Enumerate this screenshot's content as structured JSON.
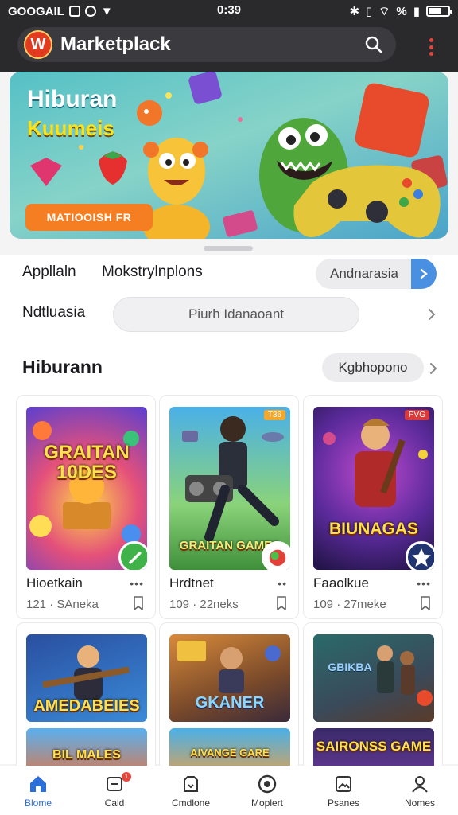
{
  "status_bar": {
    "carrier": "GOOGAIL",
    "time": "0:39",
    "battery": "%"
  },
  "app_bar": {
    "title": "Marketplack"
  },
  "hero": {
    "title": "Hiburan",
    "subtitle": "Kuumeis",
    "cta": "MATIOOISH FR"
  },
  "filters": {
    "label_apps": "Appllaln",
    "label_marketplace": "Mokstrylnplons",
    "language": "Andnarasia",
    "label_national": "Ndtluasia",
    "search_placeholder": "Piurh Idanaoant"
  },
  "section": {
    "title": "Hiburann",
    "category": "Kgbhopono"
  },
  "cards": [
    {
      "art": "GRAITAN 10DES",
      "title": "Hioetkain",
      "meta": "121 · SAneka"
    },
    {
      "art": "GRAITAN GAMES",
      "title": "Hrdtnet",
      "meta": "109 · 22neks",
      "badge": "T36"
    },
    {
      "art": "BIUNAGAS",
      "title": "Faaolkue",
      "meta": "109 · 27meke",
      "badge": "PVG"
    }
  ],
  "cards_row2": [
    {
      "art": "AMEDABEIES",
      "art2": "BIL MALES"
    },
    {
      "art": "GKANER",
      "art2": "AIVANGE GARE"
    },
    {
      "art": "GBIKBA",
      "art2": "SAIRONSS GAME"
    }
  ],
  "bottom_nav": [
    {
      "label": "Blome",
      "icon": "home-icon",
      "active": true
    },
    {
      "label": "Cald",
      "icon": "card-icon",
      "badge": "1"
    },
    {
      "label": "Cmdlone",
      "icon": "package-icon"
    },
    {
      "label": "Moplert",
      "icon": "compass-icon"
    },
    {
      "label": "Psanes",
      "icon": "gallery-icon"
    },
    {
      "label": "Nomes",
      "icon": "user-icon"
    }
  ],
  "colors": {
    "accent": "#2c6fd8",
    "topbar": "#2a2a2d",
    "cta": "#f57e22"
  }
}
